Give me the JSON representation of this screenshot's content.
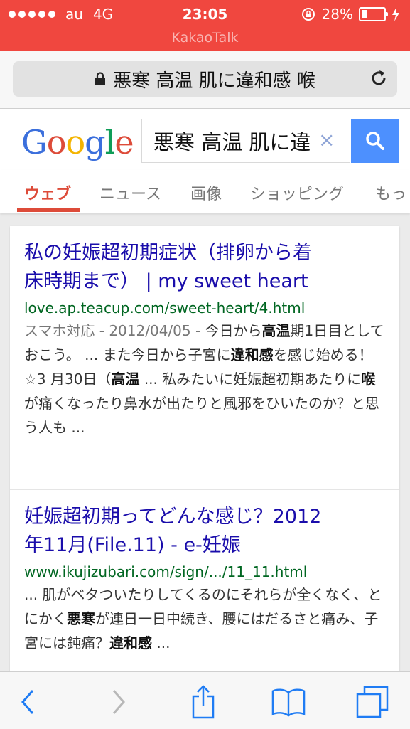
{
  "status_bar": {
    "carrier": "au",
    "network": "4G",
    "time": "23:05",
    "battery_percent_text": "28%",
    "battery_level": 0.28,
    "foreground_app": "KakaoTalk"
  },
  "address_bar": {
    "query_text": "悪寒 高温 肌に違和感 喉"
  },
  "google": {
    "logo_text": "Google",
    "logo_letters": [
      "G",
      "o",
      "o",
      "g",
      "l",
      "e"
    ],
    "logo_colors": [
      "#3b6fdc",
      "#dd4b39",
      "#f4b400",
      "#3b6fdc",
      "#0f9d58",
      "#dd4b39"
    ],
    "search_value": "悪寒 高温 肌に違",
    "clear_symbol": "×",
    "search_button_color": "#4d90fe"
  },
  "tabs": [
    {
      "label": "ウェブ",
      "active": true
    },
    {
      "label": "ニュース",
      "active": false
    },
    {
      "label": "画像",
      "active": false
    },
    {
      "label": "ショッピング",
      "active": false
    },
    {
      "label": "もっ",
      "active": false
    }
  ],
  "results": [
    {
      "title_line1": "私の妊娠超初期症状（排卵から着",
      "title_line2": "床時期まで） | my sweet heart",
      "url": "love.ap.teacup.com/sweet-heart/4.html",
      "meta": "スマホ対応 - 2012/04/05 - ",
      "snippet": [
        {
          "t": "今日から",
          "b": false
        },
        {
          "t": "高温",
          "b": true
        },
        {
          "t": "期1日目としておこう。 ... また今日から子宮に",
          "b": false
        },
        {
          "t": "違和感",
          "b": true
        },
        {
          "t": "を感じ始める！ ☆3 月30日（",
          "b": false
        },
        {
          "t": "高温",
          "b": true
        },
        {
          "t": " ... 私みたいに妊娠超初期あたりに",
          "b": false
        },
        {
          "t": "喉",
          "b": true
        },
        {
          "t": "が痛くなったり鼻水が出たりと風邪をひいたのか？と思う人も ...",
          "b": false
        }
      ]
    },
    {
      "title_line1": "妊娠超初期ってどんな感じ？2012",
      "title_line2": "年11月(File.11) - e-妊娠",
      "url": "www.ikujizubari.com/sign/.../11_11.html",
      "meta": "",
      "snippet": [
        {
          "t": "... 肌がベタついたりしてくるのにそれらが全くなく、とにかく",
          "b": false
        },
        {
          "t": "悪寒",
          "b": true
        },
        {
          "t": "が連日一日中続き、腰にはだるさと痛み、子宮には鈍痛？",
          "b": false
        },
        {
          "t": "違和感",
          "b": true
        },
        {
          "t": " ...",
          "b": false
        }
      ]
    }
  ],
  "toolbar": {
    "items": [
      "back-icon",
      "forward-icon",
      "share-icon",
      "bookmarks-icon",
      "tabs-icon"
    ],
    "accent": "#1f7cf4",
    "disabled": "#b8b8b8"
  }
}
